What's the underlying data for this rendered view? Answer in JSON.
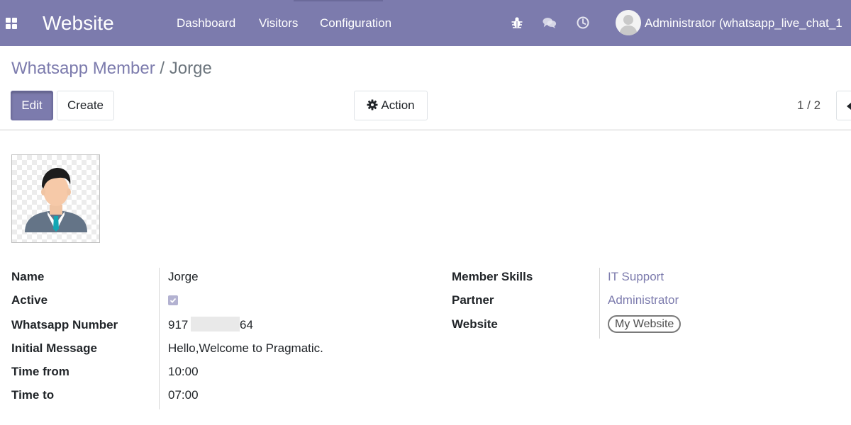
{
  "navbar": {
    "app_title": "Website",
    "menu": [
      "Dashboard",
      "Visitors",
      "Configuration"
    ],
    "user_name": "Administrator (whatsapp_live_chat_1",
    "icons": [
      "apps-icon",
      "bug-icon",
      "chat-icon",
      "clock-icon"
    ]
  },
  "breadcrumb": {
    "parent": "Whatsapp Member",
    "separator": "/",
    "current": "Jorge"
  },
  "buttons": {
    "edit": "Edit",
    "create": "Create",
    "action": "Action"
  },
  "pager": {
    "value": "1 / 2"
  },
  "form": {
    "name_label": "Name",
    "name": "Jorge",
    "active_label": "Active",
    "active": true,
    "whatsapp_label": "Whatsapp Number",
    "whatsapp_prefix": "917",
    "whatsapp_suffix": "64",
    "initial_message_label": "Initial Message",
    "initial_message": "Hello,Welcome to Pragmatic.",
    "time_from_label": "Time from",
    "time_from": "10:00",
    "time_to_label": "Time to",
    "time_to": "07:00",
    "member_skills_label": "Member Skills",
    "member_skills": "IT Support",
    "partner_label": "Partner",
    "partner": "Administrator",
    "website_label": "Website",
    "website": "My Website"
  },
  "colors": {
    "brand": "#7c7bad",
    "link": "#7c7bad"
  }
}
